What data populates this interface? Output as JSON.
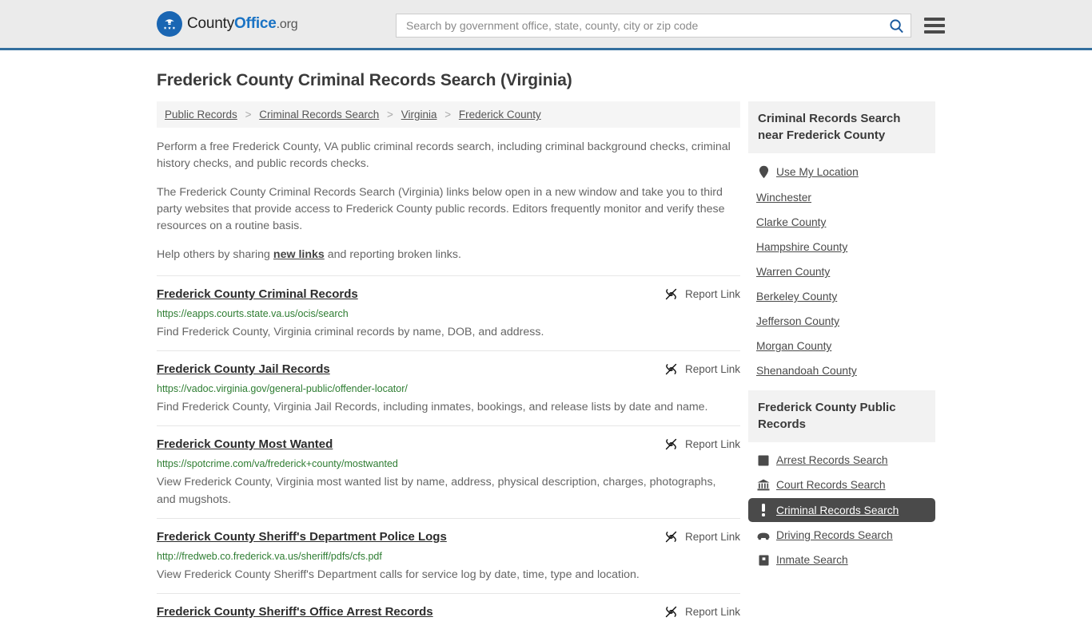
{
  "header": {
    "logo": {
      "icon": "eagle-seal-icon",
      "text_county": "County",
      "text_office": "Office",
      "text_org": ".org"
    },
    "search": {
      "placeholder": "Search by government office, state, county, city or zip code",
      "value": "",
      "search_icon": "search-icon"
    },
    "menu_icon": "hamburger-menu-icon"
  },
  "page_title": "Frederick County Criminal Records Search (Virginia)",
  "breadcrumb": {
    "separator": ">",
    "items": [
      {
        "label": "Public Records"
      },
      {
        "label": "Criminal Records Search"
      },
      {
        "label": "Virginia"
      },
      {
        "label": "Frederick County"
      }
    ]
  },
  "intro": {
    "p1": "Perform a free Frederick County, VA public criminal records search, including criminal background checks, criminal history checks, and public records checks.",
    "p2": "The Frederick County Criminal Records Search (Virginia) links below open in a new window and take you to third party websites that provide access to Frederick County public records. Editors frequently monitor and verify these resources on a routine basis.",
    "p3_before": "Help others by sharing ",
    "p3_link": "new links",
    "p3_after": " and reporting broken links."
  },
  "report_link_label": "Report Link",
  "report_link_icon": "broken-link-icon",
  "listings": [
    {
      "title": "Frederick County Criminal Records",
      "url": "https://eapps.courts.state.va.us/ocis/search",
      "description": "Find Frederick County, Virginia criminal records by name, DOB, and address."
    },
    {
      "title": "Frederick County Jail Records",
      "url": "https://vadoc.virginia.gov/general-public/offender-locator/",
      "description": "Find Frederick County, Virginia Jail Records, including inmates, bookings, and release lists by date and name."
    },
    {
      "title": "Frederick County Most Wanted",
      "url": "https://spotcrime.com/va/frederick+county/mostwanted",
      "description": "View Frederick County, Virginia most wanted list by name, address, physical description, charges, photographs, and mugshots."
    },
    {
      "title": "Frederick County Sheriff's Department Police Logs",
      "url": "http://fredweb.co.frederick.va.us/sheriff/pdfs/cfs.pdf",
      "description": "View Frederick County Sheriff's Department calls for service log by date, time, type and location."
    },
    {
      "title": "Frederick County Sheriff's Office Arrest Records",
      "url": "",
      "description": ""
    }
  ],
  "sidebar": {
    "nearby_card": {
      "heading": "Criminal Records Search near Frederick County",
      "items": [
        {
          "label": "Use My Location",
          "icon": "map-pin-icon",
          "active": false
        },
        {
          "label": "Winchester",
          "icon": "",
          "active": false
        },
        {
          "label": "Clarke County",
          "icon": "",
          "active": false
        },
        {
          "label": "Hampshire County",
          "icon": "",
          "active": false
        },
        {
          "label": "Warren County",
          "icon": "",
          "active": false
        },
        {
          "label": "Berkeley County",
          "icon": "",
          "active": false
        },
        {
          "label": "Jefferson County",
          "icon": "",
          "active": false
        },
        {
          "label": "Morgan County",
          "icon": "",
          "active": false
        },
        {
          "label": "Shenandoah County",
          "icon": "",
          "active": false
        }
      ]
    },
    "records_card": {
      "heading": "Frederick County Public Records",
      "items": [
        {
          "label": "Arrest Records Search",
          "icon": "fingerprint-icon",
          "active": false
        },
        {
          "label": "Court Records Search",
          "icon": "courthouse-icon",
          "active": false
        },
        {
          "label": "Criminal Records Search",
          "icon": "exclamation-icon",
          "active": true
        },
        {
          "label": "Driving Records Search",
          "icon": "car-icon",
          "active": false
        },
        {
          "label": "Inmate Search",
          "icon": "inmate-icon",
          "active": false
        }
      ]
    }
  },
  "colors": {
    "header_bg": "#ebebeb",
    "header_border": "#336f9e",
    "brand_blue": "#1a73c4",
    "url_green": "#2e7d32",
    "active_bg": "#4a4a4a"
  }
}
